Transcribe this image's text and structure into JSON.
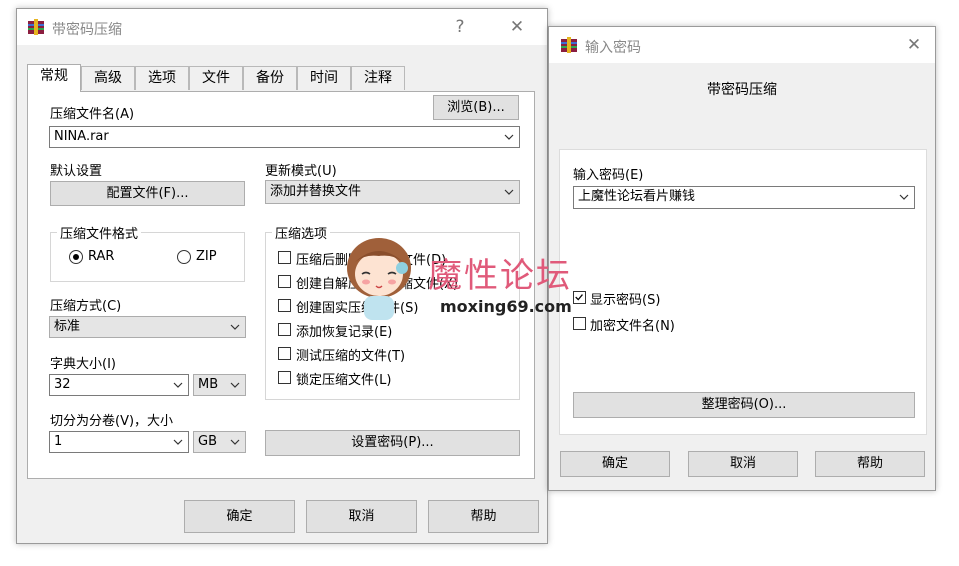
{
  "main_dialog": {
    "title": "带密码压缩",
    "help_glyph": "?",
    "close_glyph": "✕",
    "tabs": [
      {
        "label": "常规"
      },
      {
        "label": "高级"
      },
      {
        "label": "选项"
      },
      {
        "label": "文件"
      },
      {
        "label": "备份"
      },
      {
        "label": "时间"
      },
      {
        "label": "注释"
      }
    ],
    "archive_name_label": "压缩文件名(A)",
    "browse_label": "浏览(B)...",
    "archive_name_value": "NINA.rar",
    "default_settings_label": "默认设置",
    "profiles_label": "配置文件(F)...",
    "update_mode_label": "更新模式(U)",
    "update_mode_value": "添加并替换文件",
    "format_group_title": "压缩文件格式",
    "format_rar": "RAR",
    "format_zip": "ZIP",
    "options_group_title": "压缩选项",
    "options": [
      {
        "label": "压缩后删除原来的文件(D)",
        "checked": false
      },
      {
        "label": "创建自解压格式压缩文件(X)",
        "checked": false
      },
      {
        "label": "创建固实压缩文件(S)",
        "checked": false
      },
      {
        "label": "添加恢复记录(E)",
        "checked": false
      },
      {
        "label": "测试压缩的文件(T)",
        "checked": false
      },
      {
        "label": "锁定压缩文件(L)",
        "checked": false
      }
    ],
    "method_label": "压缩方式(C)",
    "method_value": "标准",
    "dict_label": "字典大小(I)",
    "dict_value": "32",
    "dict_unit": "MB",
    "split_label": "切分为分卷(V)，大小",
    "split_value": "1",
    "split_unit": "GB",
    "set_password_label": "设置密码(P)...",
    "ok_label": "确定",
    "cancel_label": "取消",
    "help_label": "帮助"
  },
  "password_dialog": {
    "title": "输入密码",
    "close_glyph": "✕",
    "heading": "带密码压缩",
    "enter_label": "输入密码(E)",
    "password_value": "上魔性论坛看片赚钱",
    "show_password_label": "显示密码(S)",
    "show_password_checked": true,
    "encrypt_names_label": "加密文件名(N)",
    "encrypt_names_checked": false,
    "organize_label": "整理密码(O)...",
    "ok_label": "确定",
    "cancel_label": "取消",
    "help_label": "帮助"
  },
  "watermark": {
    "text": "魔性论坛",
    "url": "moxing69.com"
  },
  "colors": {
    "dialog_bg": "#f0f0f0",
    "panel_bg": "#ffffff",
    "button_bg": "#e1e1e1",
    "border": "#adadad",
    "watermark": "#e05a7a"
  }
}
